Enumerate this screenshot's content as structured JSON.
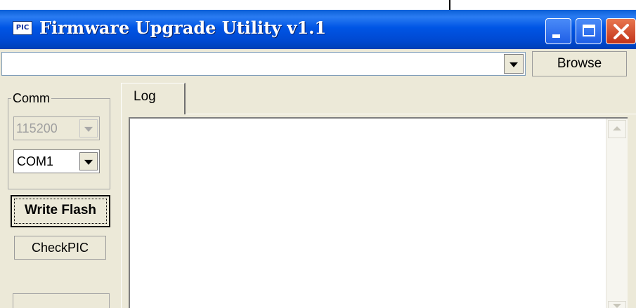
{
  "window": {
    "title": "Firmware Upgrade Utility v1.1",
    "icon_text": "PIC",
    "controls": [
      "minimize-icon",
      "maximize-icon",
      "close-icon"
    ]
  },
  "path_bar": {
    "value": "",
    "browse_label": "Browse"
  },
  "comm": {
    "group_label": "Comm",
    "baud_rate": "115200",
    "port": "COM1"
  },
  "buttons": {
    "write_flash": "Write Flash",
    "check_pic": "CheckPIC"
  },
  "log": {
    "tab_label": "Log",
    "content": ""
  },
  "colors": {
    "titlebar": "#0055e5",
    "window_bg": "#ece9d8",
    "close_button": "#c2331a"
  }
}
